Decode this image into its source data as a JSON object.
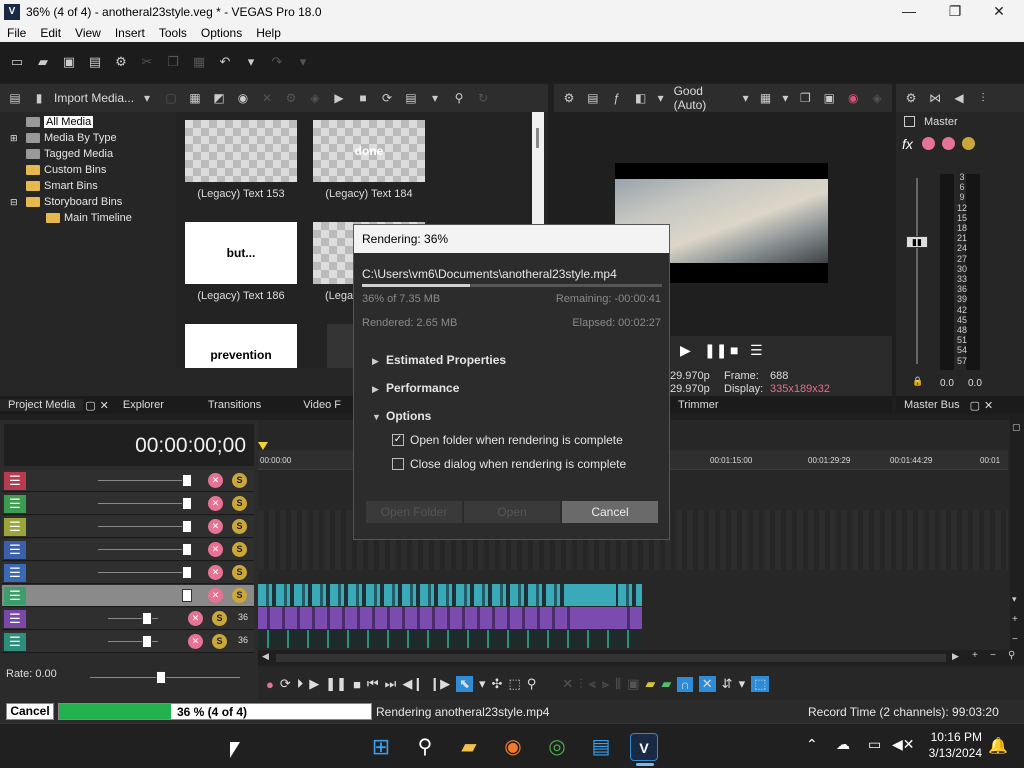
{
  "window": {
    "title": "36% (4 of 4) - anotheral23style.veg * - VEGAS Pro 18.0",
    "app_icon": "V",
    "controls": {
      "minimize": "—",
      "maximize": "❐",
      "close": "✕"
    }
  },
  "menu": [
    "File",
    "Edit",
    "View",
    "Insert",
    "Tools",
    "Options",
    "Help"
  ],
  "media_panel": {
    "import_label": "Import Media...",
    "tree": [
      "All Media",
      "Media By Type",
      "Tagged Media",
      "Custom Bins",
      "Smart Bins",
      "Storyboard Bins",
      "Main Timeline"
    ],
    "thumbs": [
      {
        "text": "",
        "caption": "(Legacy) Text 153"
      },
      {
        "text": "done",
        "caption": "(Legacy) Text 184"
      },
      {
        "text": "but...",
        "caption": "(Legacy) Text 186"
      },
      {
        "text": "",
        "caption": "(Legac"
      },
      {
        "text": "prevention",
        "caption": ""
      }
    ],
    "tabs": [
      "Project Media",
      "Explorer",
      "Transitions",
      "Video F"
    ]
  },
  "preview": {
    "quality": "Good (Auto)",
    "framerate1": "29.970p",
    "framerate2": "29.970p",
    "frame_label": "Frame:",
    "frame_value": "688",
    "display_label": "Display:",
    "display_value": "335x189x32",
    "trimmer_tab": "Trimmer"
  },
  "master": {
    "label": "Master",
    "scale": [
      "3",
      "6",
      "9",
      "12",
      "15",
      "18",
      "21",
      "24",
      "27",
      "30",
      "33",
      "36",
      "39",
      "42",
      "45",
      "48",
      "51",
      "54",
      "57"
    ],
    "levels": [
      "0.0",
      "0.0"
    ],
    "tab": "Master Bus"
  },
  "timeline": {
    "timecode": "00:00:00;00",
    "ruler": [
      "00:00:00",
      "00:01:15:00",
      "00:01:29:29",
      "00:01:44:29",
      "00:01"
    ],
    "rate": "Rate: 0.00",
    "track_colors": [
      "#b83b4f",
      "#3d9b52",
      "#9aa63a",
      "#3c5fa8",
      "#3c6ab2",
      "#3c9e6a",
      "#7a49a8",
      "#2f8d7b"
    ],
    "small_labels": [
      "36",
      "36"
    ]
  },
  "dialog": {
    "title": "Rendering: 36%",
    "path": "C:\\Users\\vm6\\Documents\\anotheral23style.mp4",
    "progress": 0.36,
    "progress_text": "36% of 7.35 MB",
    "remaining": "Remaining: -00:00:41",
    "rendered": "Rendered: 2.65 MB",
    "elapsed": "Elapsed: 00:02:27",
    "sections": [
      "Estimated Properties",
      "Performance",
      "Options"
    ],
    "option1": "Open folder when rendering is complete",
    "option1_checked": true,
    "option2": "Close dialog when rendering is complete",
    "option2_checked": false,
    "btn_open_folder": "Open Folder",
    "btn_open": "Open",
    "btn_cancel": "Cancel"
  },
  "statusbar": {
    "cancel": "Cancel",
    "progress": 0.36,
    "progress_text": "36 % (4 of 4)",
    "rendering": "Rendering anotheral23style.mp4",
    "record_time": "Record Time (2 channels): 99:03:20"
  },
  "taskbar": {
    "time": "10:16 PM",
    "date": "3/13/2024",
    "apps": [
      "start-icon",
      "search-icon",
      "file-explorer-icon",
      "firefox-icon",
      "chrome-icon",
      "notepad-icon",
      "vegas-icon"
    ]
  },
  "colors": {
    "accent": "#2e8bd6",
    "progress_green": "#22b14c",
    "clip_cyan": "#3aa9b8",
    "clip_purple": "#7b4bb0"
  }
}
